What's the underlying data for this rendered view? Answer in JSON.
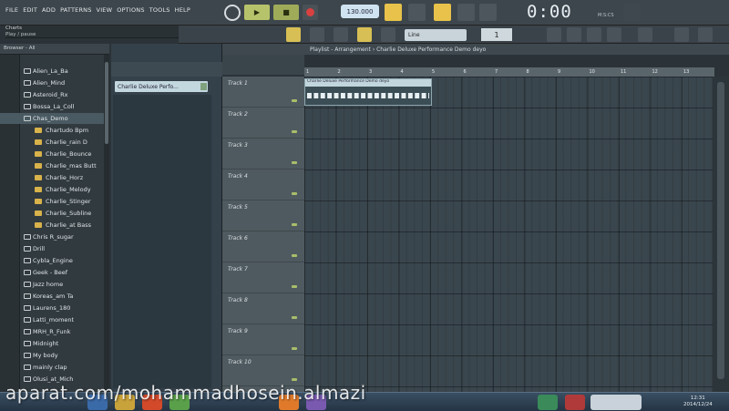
{
  "menu": [
    "FILE",
    "EDIT",
    "ADD",
    "PATTERNS",
    "VIEW",
    "OPTIONS",
    "TOOLS",
    "HELP"
  ],
  "hint": {
    "line1": "Charts",
    "line2": "Play / pause"
  },
  "transport": {
    "tempo": "130.000",
    "time": "0:00",
    "time_unit": "M:S:CS",
    "snap": "Line",
    "pattern_num": "1"
  },
  "browser": {
    "header": "Browser - All",
    "items": [
      {
        "label": "Alien_La_Ba",
        "sub": false
      },
      {
        "label": "Alien_Mind",
        "sub": false
      },
      {
        "label": "Asteroid_Rx",
        "sub": false
      },
      {
        "label": "Bossa_La_Coll",
        "sub": false
      },
      {
        "label": "Chas_Demo",
        "sub": false,
        "sel": true
      },
      {
        "label": "Chartudo Bpm",
        "sub": true
      },
      {
        "label": "Charlie_rain D",
        "sub": true
      },
      {
        "label": "Charlie_Bounce",
        "sub": true
      },
      {
        "label": "Charlie_mas Butt",
        "sub": true
      },
      {
        "label": "Charlie_Horz",
        "sub": true
      },
      {
        "label": "Charlie_Melody",
        "sub": true
      },
      {
        "label": "Charlie_Stinger",
        "sub": true
      },
      {
        "label": "Charlie_Subline",
        "sub": true
      },
      {
        "label": "Charlie_at Bass",
        "sub": true
      },
      {
        "label": "Chris R_sugar",
        "sub": false
      },
      {
        "label": "Drill",
        "sub": false
      },
      {
        "label": "Cybla_Engine",
        "sub": false
      },
      {
        "label": "Geek - Beef",
        "sub": false
      },
      {
        "label": "Jazz home",
        "sub": false
      },
      {
        "label": "Koreas_am Ta",
        "sub": false
      },
      {
        "label": "Laurens_180",
        "sub": false
      },
      {
        "label": "Latti_moment",
        "sub": false
      },
      {
        "label": "MRH_R_Funk",
        "sub": false
      },
      {
        "label": "Midnight",
        "sub": false
      },
      {
        "label": "My body",
        "sub": false
      },
      {
        "label": "mainly clap",
        "sub": false
      },
      {
        "label": "Olusi_at_Mich",
        "sub": false
      }
    ]
  },
  "panel": {
    "pattern_item": "Charlie Deluxe Perfo..."
  },
  "playlist": {
    "title": "Playlist - Arrangement  ›  Charlie Deluxe Performance Demo deyo",
    "clip_label": "Charlie Deluxe Performance Demo deyo",
    "ruler": [
      "1",
      "2",
      "3",
      "4",
      "5",
      "6",
      "7",
      "8",
      "9",
      "10",
      "11",
      "12",
      "13"
    ],
    "tracks": [
      "Track 1",
      "Track 2",
      "Track 3",
      "Track 4",
      "Track 5",
      "Track 6",
      "Track 7",
      "Track 8",
      "Track 9",
      "Track 10"
    ]
  },
  "taskbar": {
    "time": "12:31",
    "date": "2014/12/24"
  },
  "watermark": "aparat.com/mohammadhosein.almazi"
}
